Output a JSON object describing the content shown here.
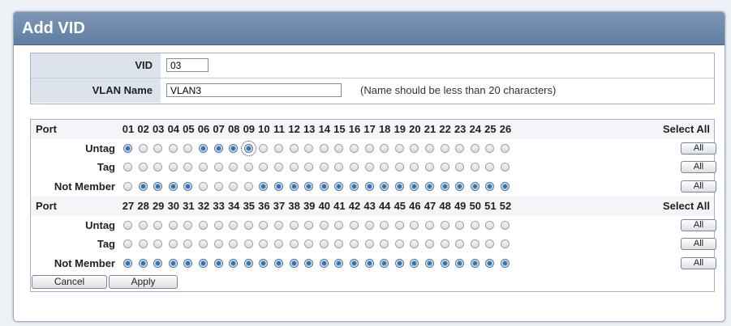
{
  "panel": {
    "title": "Add VID"
  },
  "vid": {
    "label": "VID",
    "value": "03"
  },
  "vlan_name": {
    "label": "VLAN Name",
    "value": "VLAN3",
    "note": "(Name should be less than 20 characters)"
  },
  "grid": {
    "port_label": "Port",
    "select_all_label": "Select All",
    "all_button_label": "All",
    "row_labels": [
      "Untag",
      "Tag",
      "Not Member"
    ],
    "blocks": [
      {
        "ports": [
          "01",
          "02",
          "03",
          "04",
          "05",
          "06",
          "07",
          "08",
          "09",
          "10",
          "11",
          "12",
          "13",
          "14",
          "15",
          "16",
          "17",
          "18",
          "19",
          "20",
          "21",
          "22",
          "23",
          "24",
          "25",
          "26"
        ],
        "selection": [
          "Untag",
          "Not Member",
          "Not Member",
          "Not Member",
          "Not Member",
          "Untag",
          "Untag",
          "Untag",
          "Untag",
          "Not Member",
          "Not Member",
          "Not Member",
          "Not Member",
          "Not Member",
          "Not Member",
          "Not Member",
          "Not Member",
          "Not Member",
          "Not Member",
          "Not Member",
          "Not Member",
          "Not Member",
          "Not Member",
          "Not Member",
          "Not Member",
          "Not Member"
        ],
        "focused_port": "09"
      },
      {
        "ports": [
          "27",
          "28",
          "29",
          "30",
          "31",
          "32",
          "33",
          "34",
          "35",
          "36",
          "37",
          "38",
          "39",
          "40",
          "41",
          "42",
          "43",
          "44",
          "45",
          "46",
          "47",
          "48",
          "49",
          "50",
          "51",
          "52"
        ],
        "selection": [
          "Not Member",
          "Not Member",
          "Not Member",
          "Not Member",
          "Not Member",
          "Not Member",
          "Not Member",
          "Not Member",
          "Not Member",
          "Not Member",
          "Not Member",
          "Not Member",
          "Not Member",
          "Not Member",
          "Not Member",
          "Not Member",
          "Not Member",
          "Not Member",
          "Not Member",
          "Not Member",
          "Not Member",
          "Not Member",
          "Not Member",
          "Not Member",
          "Not Member",
          "Not Member"
        ],
        "focused_port": ""
      }
    ]
  },
  "actions": {
    "cancel": "Cancel",
    "apply": "Apply"
  }
}
